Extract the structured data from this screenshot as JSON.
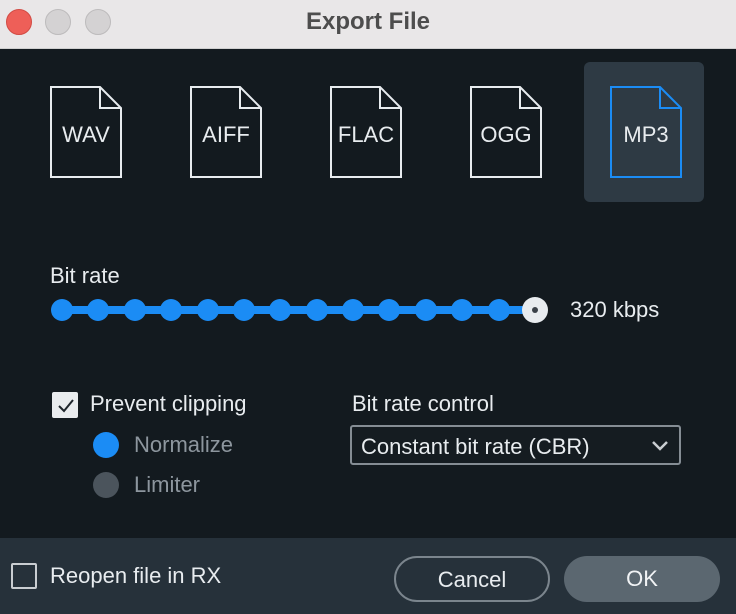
{
  "window": {
    "title": "Export File"
  },
  "formats": [
    {
      "label": "WAV",
      "selected": false
    },
    {
      "label": "AIFF",
      "selected": false
    },
    {
      "label": "FLAC",
      "selected": false
    },
    {
      "label": "OGG",
      "selected": false
    },
    {
      "label": "MP3",
      "selected": true
    }
  ],
  "bitrate": {
    "label": "Bit rate",
    "value": "320 kbps",
    "steps": 14,
    "selected_step": 14
  },
  "prevent_clipping": {
    "label": "Prevent clipping",
    "checked": true,
    "options": [
      {
        "label": "Normalize",
        "selected": true
      },
      {
        "label": "Limiter",
        "selected": false
      }
    ]
  },
  "bitrate_control": {
    "label": "Bit rate control",
    "value": "Constant bit rate (CBR)"
  },
  "footer": {
    "reopen_label": "Reopen file in RX",
    "reopen_checked": false,
    "cancel_label": "Cancel",
    "ok_label": "OK"
  },
  "colors": {
    "accent": "#1b8cf5",
    "background": "#131a1f",
    "footer": "#26313a",
    "selected_tile": "#2e3a44"
  }
}
